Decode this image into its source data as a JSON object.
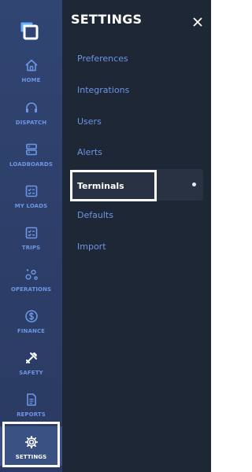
{
  "rail": {
    "items": [
      {
        "label": "HOME",
        "icon": "home-icon"
      },
      {
        "label": "DISPATCH",
        "icon": "headset-icon"
      },
      {
        "label": "LOADBOARDS",
        "icon": "server-icon"
      },
      {
        "label": "MY LOADS",
        "icon": "checklist-icon"
      },
      {
        "label": "TRIPS",
        "icon": "checklist-icon"
      },
      {
        "label": "OPERATIONS",
        "icon": "nodes-icon"
      },
      {
        "label": "FINANCE",
        "icon": "dollar-icon"
      },
      {
        "label": "SAFETY",
        "icon": "tools-icon"
      },
      {
        "label": "REPORTS",
        "icon": "document-icon"
      },
      {
        "label": "SETTINGS",
        "icon": "gear-icon"
      }
    ],
    "active": "SETTINGS"
  },
  "panel": {
    "title": "SETTINGS",
    "items": [
      "Preferences",
      "Integrations",
      "Users",
      "Alerts",
      "Terminals",
      "Defaults",
      "Import"
    ],
    "active": "Terminals"
  },
  "colors": {
    "accent": "#6d95e6",
    "rail_bg": "#2d3f69",
    "panel_bg": "#1e2735"
  }
}
